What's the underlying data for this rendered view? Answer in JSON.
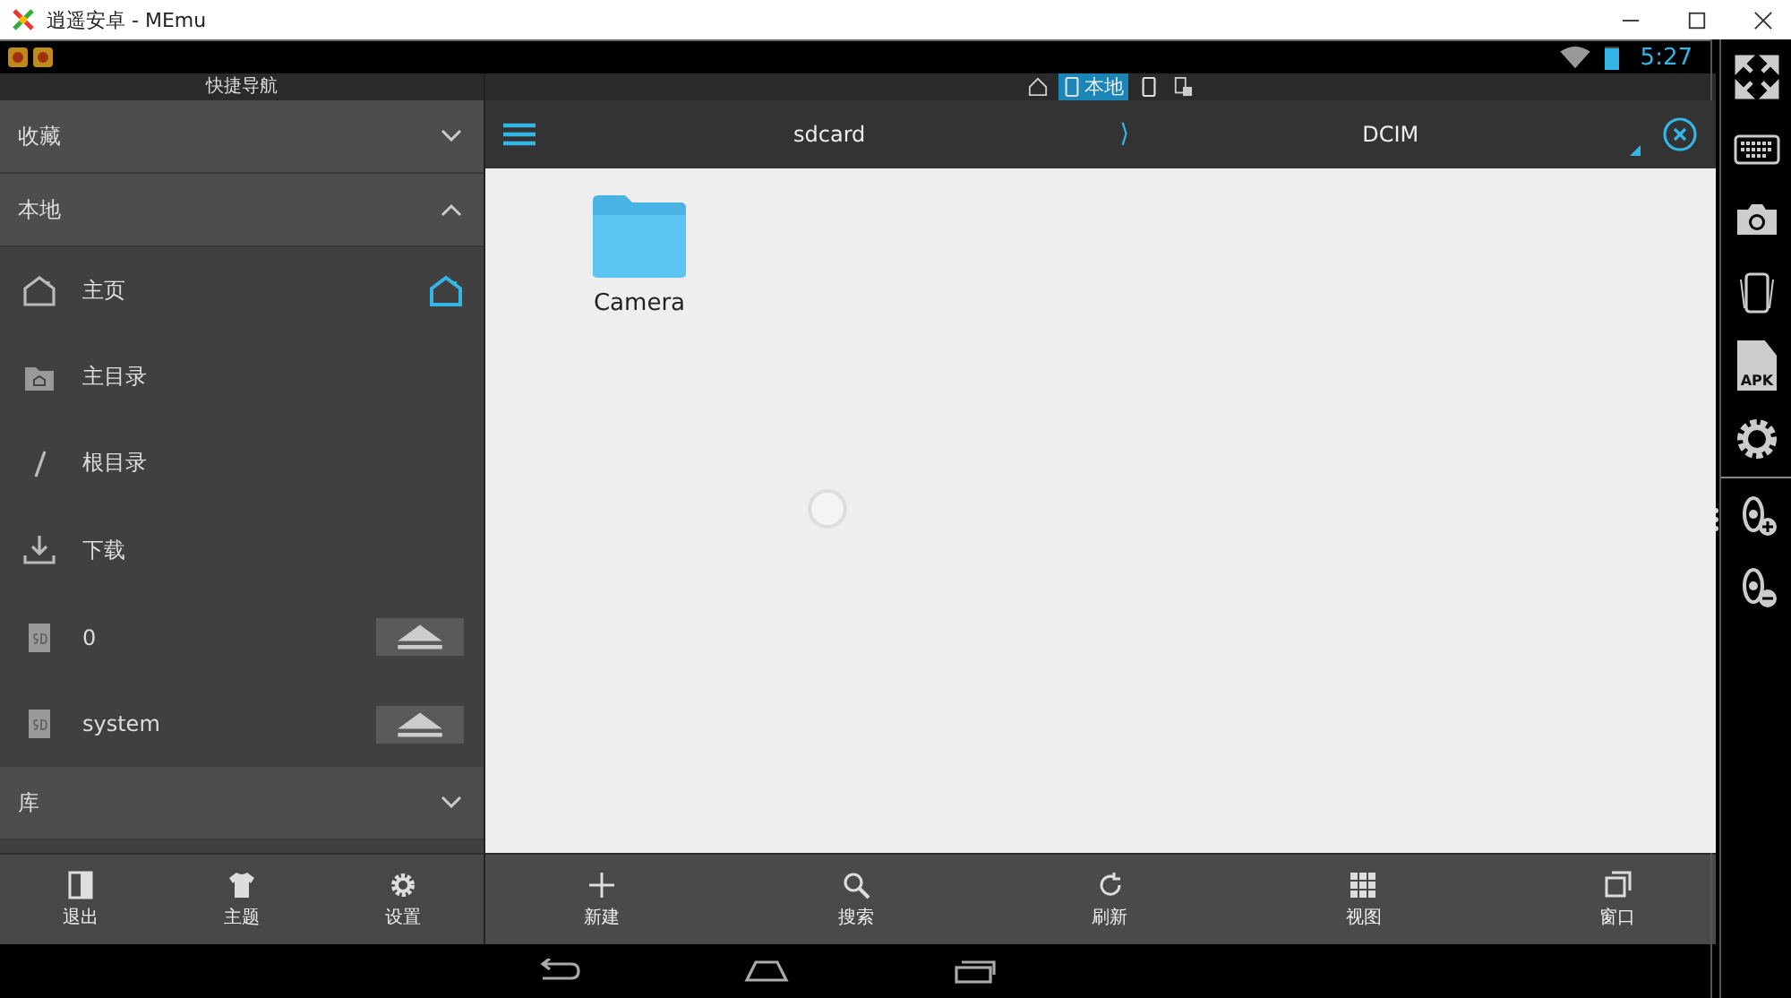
{
  "window": {
    "title": "逍遥安卓 - MEmu"
  },
  "status_bar": {
    "time": "5:27",
    "battery": {
      "level": 0.9
    }
  },
  "drawer": {
    "title": "快捷导航",
    "sections": [
      {
        "label": "收藏",
        "expanded": false
      },
      {
        "label": "本地",
        "expanded": true,
        "items": [
          {
            "kind": "home",
            "label": "主页",
            "default": true,
            "eject": false
          },
          {
            "kind": "home-folder",
            "label": "主目录",
            "default": false,
            "eject": false
          },
          {
            "kind": "root",
            "label": "根目录",
            "default": false,
            "eject": false
          },
          {
            "kind": "download",
            "label": "下载",
            "default": false,
            "eject": false
          },
          {
            "kind": "sd",
            "label": "0",
            "default": false,
            "eject": true
          },
          {
            "kind": "sd",
            "label": "system",
            "default": false,
            "eject": true
          }
        ]
      },
      {
        "label": "库",
        "expanded": false
      }
    ],
    "toolbar": [
      {
        "kind": "exit",
        "label": "退出"
      },
      {
        "kind": "theme",
        "label": "主题"
      },
      {
        "kind": "settings",
        "label": "设置"
      }
    ]
  },
  "location_tabs": [
    {
      "kind": "home",
      "selected": false
    },
    {
      "kind": "phone",
      "label": "本地",
      "selected": true
    },
    {
      "kind": "phone",
      "selected": false
    },
    {
      "kind": "remote",
      "selected": false
    }
  ],
  "breadcrumb": {
    "parts": [
      "sdcard",
      "DCIM"
    ],
    "separator": "⟩"
  },
  "files": [
    {
      "name": "Camera"
    }
  ],
  "toolbar": [
    {
      "kind": "new",
      "label": "新建"
    },
    {
      "kind": "search",
      "label": "搜索"
    },
    {
      "kind": "refresh",
      "label": "刷新"
    },
    {
      "kind": "view",
      "label": "视图"
    },
    {
      "kind": "window",
      "label": "窗口"
    }
  ],
  "side_tools": [
    {
      "kind": "fullscreen"
    },
    {
      "kind": "keyboard"
    },
    {
      "kind": "camera"
    },
    {
      "kind": "shake"
    },
    {
      "kind": "apk",
      "label": "APK"
    },
    {
      "kind": "settings"
    },
    {
      "kind": "volume-up"
    },
    {
      "kind": "volume-down"
    }
  ]
}
